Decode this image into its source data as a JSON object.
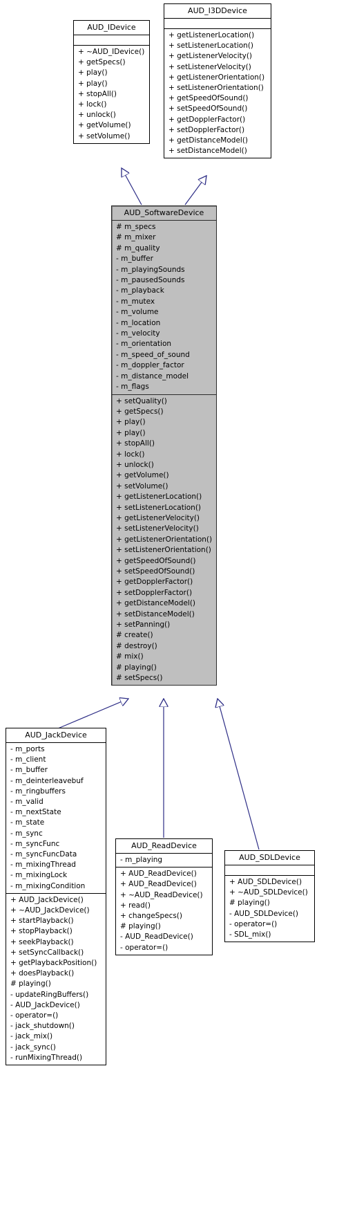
{
  "diagram": {
    "type": "uml-class-inheritance",
    "edge_color": "#2d2d86",
    "highlight_fill": "#bfbfbf",
    "plain_fill": "#ffffff"
  },
  "classes": {
    "idevice": {
      "name": "AUD_IDevice",
      "attributes": [],
      "methods": [
        "+ ~AUD_IDevice()",
        "+ getSpecs()",
        "+ play()",
        "+ play()",
        "+ stopAll()",
        "+ lock()",
        "+ unlock()",
        "+ getVolume()",
        "+ setVolume()"
      ]
    },
    "i3ddevice": {
      "name": "AUD_I3DDevice",
      "attributes": [],
      "methods": [
        "+ getListenerLocation()",
        "+ setListenerLocation()",
        "+ getListenerVelocity()",
        "+ setListenerVelocity()",
        "+ getListenerOrientation()",
        "+ setListenerOrientation()",
        "+ getSpeedOfSound()",
        "+ setSpeedOfSound()",
        "+ getDopplerFactor()",
        "+ setDopplerFactor()",
        "+ getDistanceModel()",
        "+ setDistanceModel()"
      ]
    },
    "softwaredevice": {
      "name": "AUD_SoftwareDevice",
      "attributes": [
        "# m_specs",
        "# m_mixer",
        "# m_quality",
        "- m_buffer",
        "- m_playingSounds",
        "- m_pausedSounds",
        "- m_playback",
        "- m_mutex",
        "- m_volume",
        "- m_location",
        "- m_velocity",
        "- m_orientation",
        "- m_speed_of_sound",
        "- m_doppler_factor",
        "- m_distance_model",
        "- m_flags"
      ],
      "methods": [
        "+ setQuality()",
        "+ getSpecs()",
        "+ play()",
        "+ play()",
        "+ stopAll()",
        "+ lock()",
        "+ unlock()",
        "+ getVolume()",
        "+ setVolume()",
        "+ getListenerLocation()",
        "+ setListenerLocation()",
        "+ getListenerVelocity()",
        "+ setListenerVelocity()",
        "+ getListenerOrientation()",
        "+ setListenerOrientation()",
        "+ getSpeedOfSound()",
        "+ setSpeedOfSound()",
        "+ getDopplerFactor()",
        "+ setDopplerFactor()",
        "+ getDistanceModel()",
        "+ setDistanceModel()",
        "+ setPanning()",
        "# create()",
        "# destroy()",
        "# mix()",
        "# playing()",
        "# setSpecs()"
      ]
    },
    "jackdevice": {
      "name": "AUD_JackDevice",
      "attributes": [
        "- m_ports",
        "- m_client",
        "- m_buffer",
        "- m_deinterleavebuf",
        "- m_ringbuffers",
        "- m_valid",
        "- m_nextState",
        "- m_state",
        "- m_sync",
        "- m_syncFunc",
        "- m_syncFuncData",
        "- m_mixingThread",
        "- m_mixingLock",
        "- m_mixingCondition"
      ],
      "methods": [
        "+ AUD_JackDevice()",
        "+ ~AUD_JackDevice()",
        "+ startPlayback()",
        "+ stopPlayback()",
        "+ seekPlayback()",
        "+ setSyncCallback()",
        "+ getPlaybackPosition()",
        "+ doesPlayback()",
        "# playing()",
        "- updateRingBuffers()",
        "- AUD_JackDevice()",
        "- operator=()",
        "- jack_shutdown()",
        "- jack_mix()",
        "- jack_sync()",
        "- runMixingThread()"
      ]
    },
    "readdevice": {
      "name": "AUD_ReadDevice",
      "attributes": [
        "- m_playing"
      ],
      "methods": [
        "+ AUD_ReadDevice()",
        "+ AUD_ReadDevice()",
        "+ ~AUD_ReadDevice()",
        "+ read()",
        "+ changeSpecs()",
        "# playing()",
        "- AUD_ReadDevice()",
        "- operator=()"
      ]
    },
    "sdldevice": {
      "name": "AUD_SDLDevice",
      "attributes": [],
      "methods": [
        "+ AUD_SDLDevice()",
        "+ ~AUD_SDLDevice()",
        "# playing()",
        "- AUD_SDLDevice()",
        "- operator=()",
        "- SDL_mix()"
      ]
    }
  }
}
